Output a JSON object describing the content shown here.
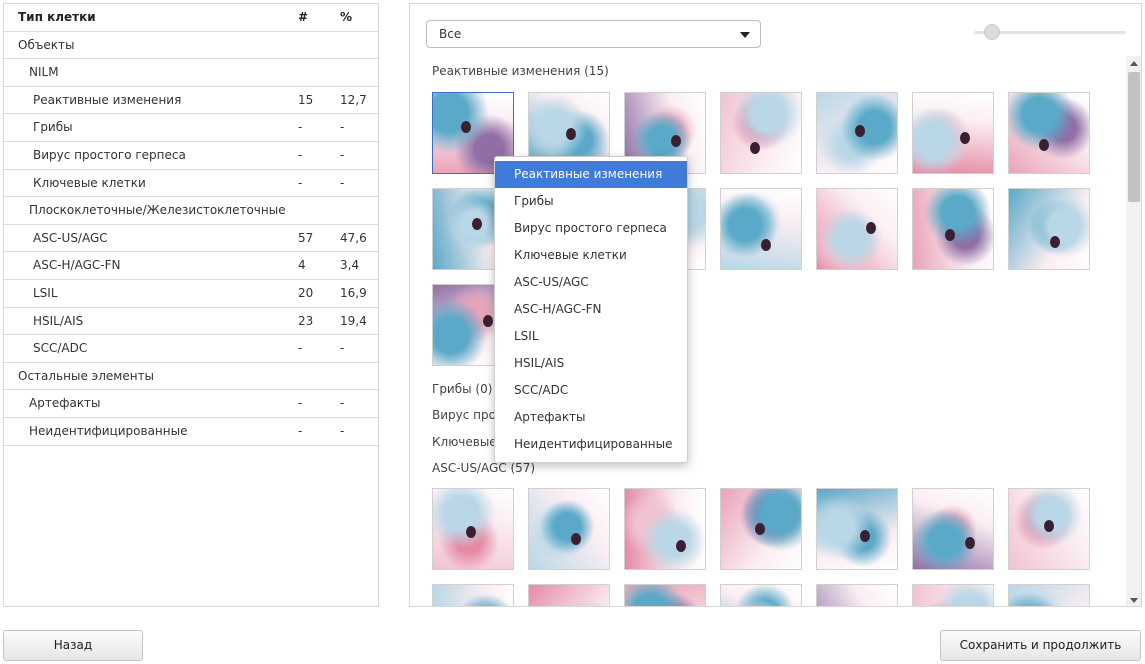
{
  "stats_table": {
    "headers": {
      "type": "Тип клетки",
      "count": "#",
      "percent": "%"
    },
    "rows": [
      {
        "label": "Объекты",
        "count": "",
        "percent": "",
        "depth": 0
      },
      {
        "label": "NILM",
        "count": "",
        "percent": "",
        "depth": 1
      },
      {
        "label": "Реактивные изменения",
        "count": "15",
        "percent": "12,7",
        "depth": 2
      },
      {
        "label": "Грибы",
        "count": "-",
        "percent": "-",
        "depth": 2
      },
      {
        "label": "Вирус простого герпеса",
        "count": "-",
        "percent": "-",
        "depth": 2
      },
      {
        "label": "Ключевые клетки",
        "count": "-",
        "percent": "-",
        "depth": 2
      },
      {
        "label": "Плоскоклеточные/Железистоклеточные",
        "count": "",
        "percent": "",
        "depth": 1
      },
      {
        "label": "ASC-US/AGC",
        "count": "57",
        "percent": "47,6",
        "depth": 2
      },
      {
        "label": "ASC-H/AGC-FN",
        "count": "4",
        "percent": "3,4",
        "depth": 2
      },
      {
        "label": "LSIL",
        "count": "20",
        "percent": "16,9",
        "depth": 2
      },
      {
        "label": "HSIL/AIS",
        "count": "23",
        "percent": "19,4",
        "depth": 2
      },
      {
        "label": "SCC/ADC",
        "count": "-",
        "percent": "-",
        "depth": 2
      },
      {
        "label": "Остальные элементы",
        "count": "",
        "percent": "",
        "depth": 0
      },
      {
        "label": "Артефакты",
        "count": "-",
        "percent": "-",
        "depth": 1
      },
      {
        "label": "Неидентифицированные",
        "count": "-",
        "percent": "-",
        "depth": 1
      }
    ]
  },
  "filter": {
    "selected": "Все"
  },
  "gallery": {
    "sections": [
      {
        "title": "Реактивные изменения (15)"
      },
      {
        "title": "Грибы (0)"
      },
      {
        "title": "Вирус просто"
      },
      {
        "title": "Ключевые"
      },
      {
        "title": "ASC-US/AGC (57)"
      }
    ]
  },
  "context_menu": {
    "items": [
      "Реактивные изменения",
      "Грибы",
      "Вирус простого герпеса",
      "Ключевые клетки",
      "ASC-US/AGC",
      "ASC-H/AGC-FN",
      "LSIL",
      "HSIL/AIS",
      "SCC/ADC",
      "Артефакты",
      "Неидентифицированные"
    ],
    "highlighted_index": 0
  },
  "footer": {
    "back_label": "Назад",
    "save_label": "Сохранить и продолжить"
  },
  "colors": {
    "stain_pink": "#e9a3b8",
    "stain_blue": "#5aa9c8",
    "stain_violet": "#8f6fa6",
    "nucleus": "#3a1f33",
    "menu_highlight": "#3f7bd8"
  }
}
